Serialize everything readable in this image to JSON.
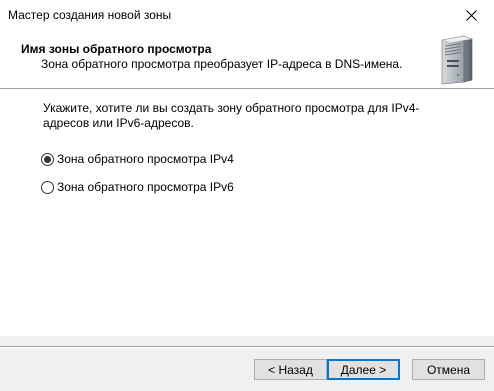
{
  "window": {
    "title": "Мастер создания новой зоны"
  },
  "header": {
    "title": "Имя зоны обратного просмотра",
    "subtitle": "Зона обратного просмотра преобразует IP-адреса в DNS-имена.",
    "icon": "server-icon"
  },
  "content": {
    "prompt": "Укажите, хотите ли вы создать зону обратного просмотра для IPv4-адресов или IPv6-адресов.",
    "options": [
      {
        "label": "Зона обратного просмотра IPv4",
        "checked": true
      },
      {
        "label": "Зона обратного просмотра IPv6",
        "checked": false
      }
    ]
  },
  "buttons": {
    "back": "< Назад",
    "next": "Далее >",
    "cancel": "Отмена"
  },
  "colors": {
    "accent": "#0078d7",
    "button_bg": "#e1e1e1",
    "dialog_bg": "#f0f0f0"
  }
}
